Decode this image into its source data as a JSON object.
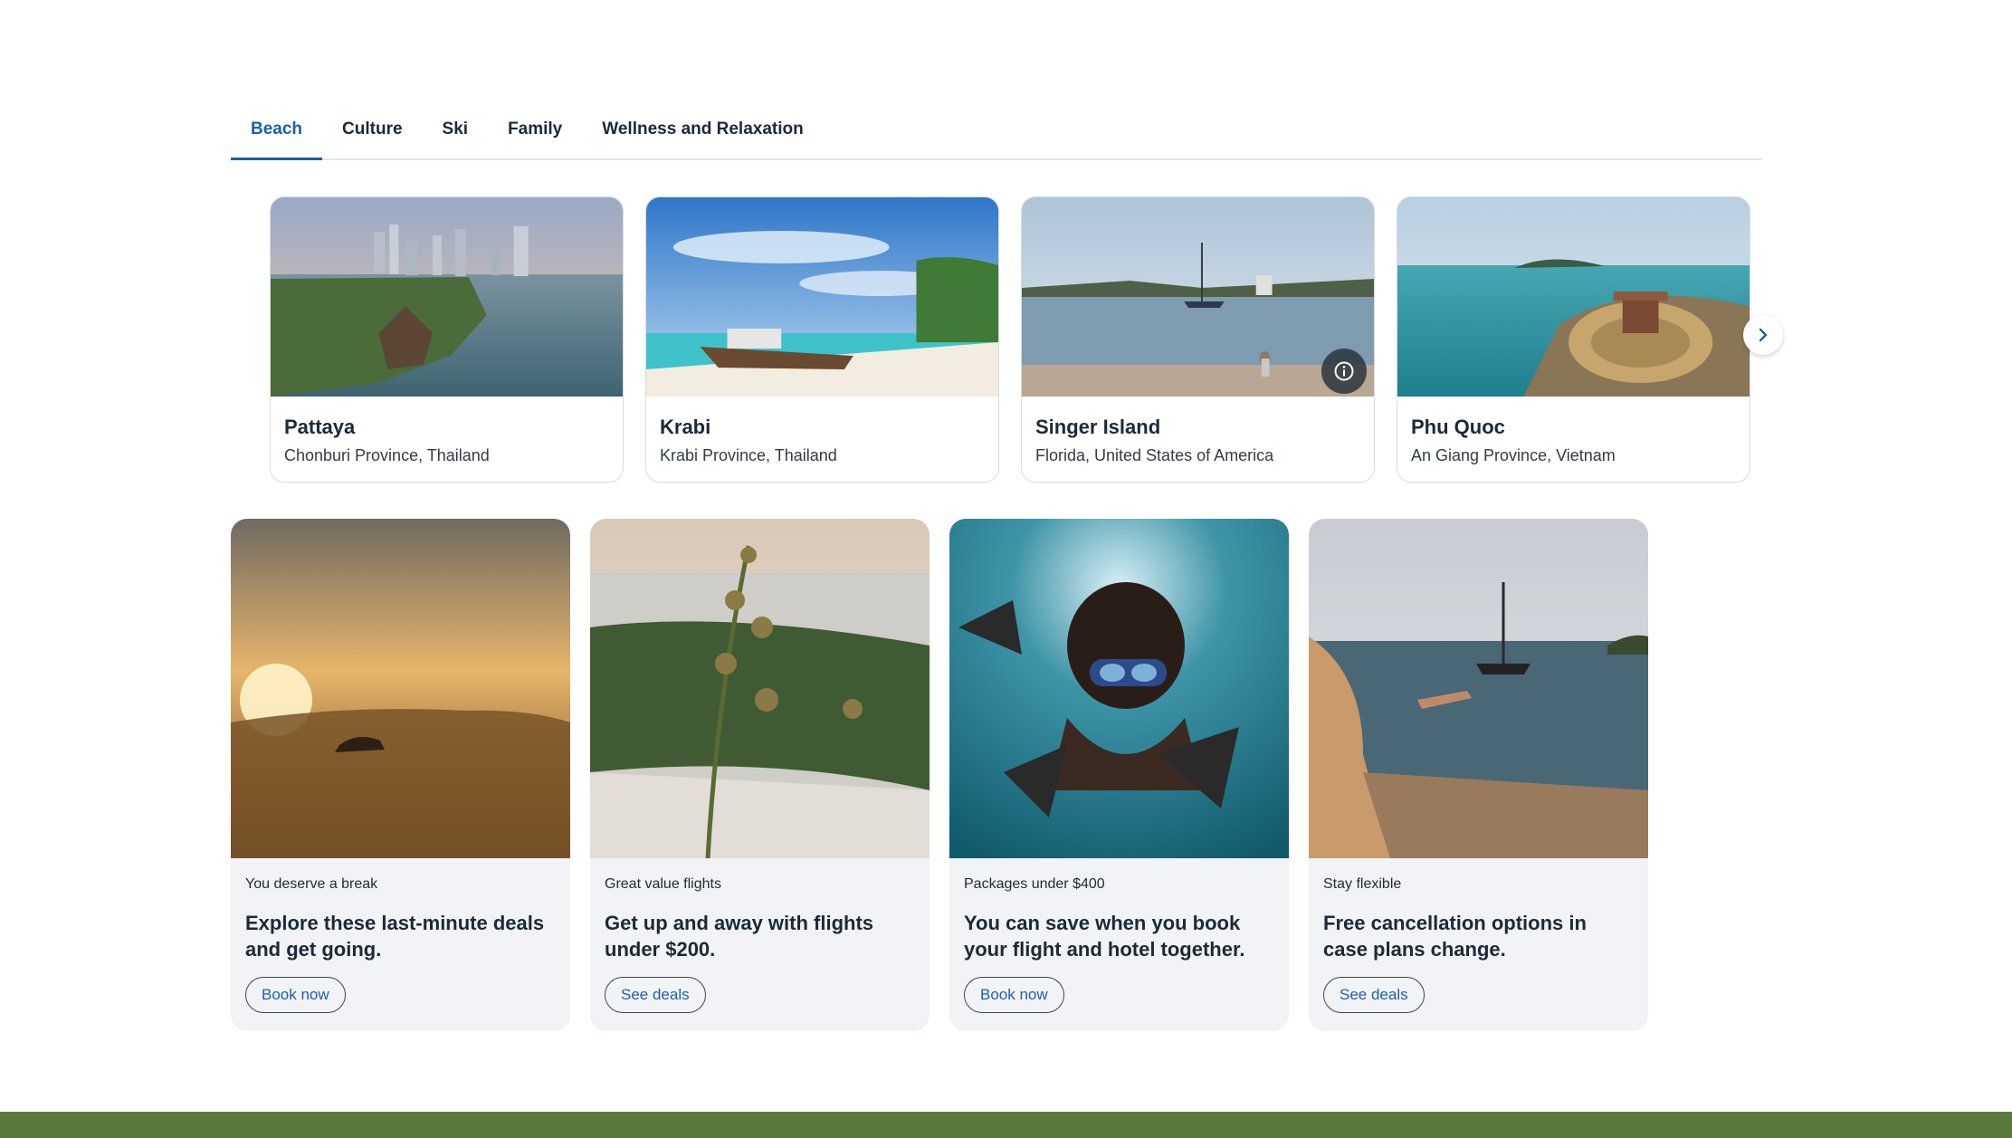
{
  "tabs": [
    {
      "label": "Beach",
      "active": true
    },
    {
      "label": "Culture",
      "active": false
    },
    {
      "label": "Ski",
      "active": false
    },
    {
      "label": "Family",
      "active": false
    },
    {
      "label": "Wellness and Relaxation",
      "active": false
    }
  ],
  "destinations": [
    {
      "name": "Pattaya",
      "location": "Chonburi Province, Thailand"
    },
    {
      "name": "Krabi",
      "location": "Krabi Province, Thailand"
    },
    {
      "name": "Singer Island",
      "location": "Florida, United States of America"
    },
    {
      "name": "Phu Quoc",
      "location": "An Giang Province, Vietnam"
    }
  ],
  "promos": [
    {
      "kicker": "You deserve a break",
      "title": "Explore these last-minute deals and get going.",
      "button": "Book now"
    },
    {
      "kicker": "Great value flights",
      "title": "Get up and away with flights under $200.",
      "button": "See deals"
    },
    {
      "kicker": "Packages under $400",
      "title": "You can save when you book your flight and hotel together.",
      "button": "Book now"
    },
    {
      "kicker": "Stay flexible",
      "title": "Free cancellation options in case plans change.",
      "button": "See deals"
    }
  ],
  "icons": {
    "info": "info-icon",
    "next": "chevron-right-icon"
  },
  "colors": {
    "accent": "#1b5fb0",
    "footer": "#5a7a3c",
    "card_bg": "#f2f3f6"
  }
}
